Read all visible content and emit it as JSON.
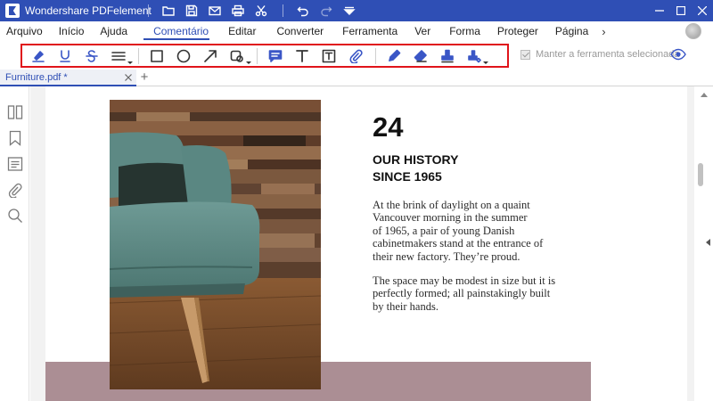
{
  "app": {
    "title": "Wondershare PDFelement",
    "quick_access": [
      "folder-icon",
      "save-icon",
      "mail-icon",
      "print-icon",
      "scissors-icon",
      "undo-icon",
      "redo-icon",
      "dropdown-icon"
    ]
  },
  "menu": {
    "items": [
      "Arquivo",
      "Início",
      "Ajuda",
      "Comentário",
      "Editar",
      "Converter",
      "Ferramenta",
      "Ver",
      "Forma",
      "Proteger",
      "Página"
    ],
    "active": "Comentário",
    "more": "›"
  },
  "toolbar": {
    "groups": [
      [
        "highlight-icon",
        "underline-icon",
        "strikethrough-icon",
        "lines-icon"
      ],
      [
        "rectangle-icon",
        "circle-icon",
        "arrow-icon",
        "shape-icon"
      ],
      [
        "note-icon",
        "text-icon",
        "textbox-icon",
        "attachment-icon"
      ],
      [
        "pencil-icon",
        "eraser-icon",
        "stamp-icon",
        "signature-icon"
      ]
    ],
    "keep_tool_label": "Manter a ferramenta selecionada",
    "keep_tool_checked": true,
    "accent": "#3a56c6",
    "highlight_border": "#e0141a"
  },
  "tabs": {
    "active_doc": "Furniture.pdf *",
    "add_label": "+"
  },
  "document": {
    "number": "24",
    "heading_line1": "OUR HISTORY",
    "heading_line2": "SINCE 1965",
    "para1": [
      "At the brink of daylight on a quaint",
      "Vancouver morning in the summer",
      "of 1965, a pair of young Danish",
      "cabinetmakers stand at the entrance of",
      "their new factory. They’re proud."
    ],
    "para2": [
      "The space may be modest in size but it is",
      "perfectly formed; all painstakingly built",
      "by their hands."
    ],
    "band_color": "#ab8e94"
  },
  "colors": {
    "title_bar": "#2f4fb5"
  }
}
